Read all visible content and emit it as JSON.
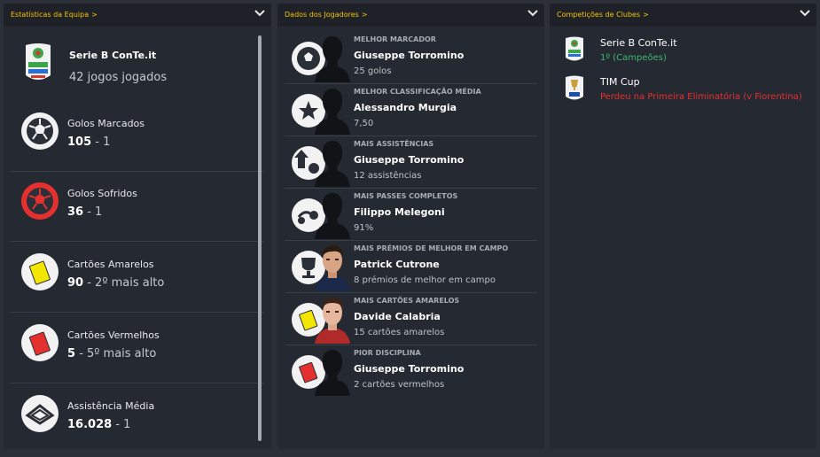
{
  "colors": {
    "accent": "#f5c500",
    "success": "#3db870",
    "danger": "#e4312f"
  },
  "team_stats": {
    "title": "Estatísticas da Equipa",
    "competition": {
      "name": "Serie B ConTe.it",
      "played": "42 jogos jogados",
      "badge": "serie-b-logo"
    },
    "items": [
      {
        "label": "Golos Marcados",
        "value": "105",
        "rank": "- 1",
        "icon": "football-icon"
      },
      {
        "label": "Golos Sofridos",
        "value": "36",
        "rank": "- 1",
        "icon": "conceded-ball-icon"
      },
      {
        "label": "Cartões Amarelos",
        "value": "90",
        "rank": "- 2º mais alto",
        "icon": "yellow-card-icon"
      },
      {
        "label": "Cartões Vermelhos",
        "value": "5",
        "rank": "- 5º mais alto",
        "icon": "red-card-icon"
      },
      {
        "label": "Assistência Média",
        "value": "16.028",
        "rank": "- 1",
        "icon": "stadium-icon"
      }
    ]
  },
  "player_stats": {
    "title": "Dados dos Jogadores",
    "items": [
      {
        "category": "Melhor Marcador",
        "player": "Giuseppe Torromino",
        "stat": "25 golos",
        "icon": "football-icon",
        "has_photo": false
      },
      {
        "category": "Melhor Classificação Média",
        "player": "Alessandro Murgia",
        "stat": "7,50",
        "icon": "star-icon",
        "has_photo": false
      },
      {
        "category": "Mais Assistências",
        "player": "Giuseppe Torromino",
        "stat": "12 assistências",
        "icon": "assist-icon",
        "has_photo": false
      },
      {
        "category": "Mais Passes Completos",
        "player": "Filippo Melegoni",
        "stat": "91%",
        "icon": "pass-icon",
        "has_photo": false
      },
      {
        "category": "Mais Prémios de Melhor em Campo",
        "player": "Patrick Cutrone",
        "stat": "8 prémios de melhor em campo",
        "icon": "trophy-icon",
        "has_photo": true
      },
      {
        "category": "Mais Cartões Amarelos",
        "player": "Davide Calabria",
        "stat": "15 cartões amarelos",
        "icon": "yellow-card-icon",
        "has_photo": true
      },
      {
        "category": "Pior Disciplina",
        "player": "Giuseppe Torromino",
        "stat": "2 cartões vermelhos",
        "icon": "red-card-icon",
        "has_photo": false
      }
    ]
  },
  "club_comps": {
    "title": "Competições de Clubes",
    "items": [
      {
        "name": "Serie B ConTe.it",
        "result": "1º (Campeões)",
        "status": "success",
        "badge": "serie-b-logo"
      },
      {
        "name": "TIM Cup",
        "result": "Perdeu na Primeira Eliminatória (v Fiorentina)",
        "status": "danger",
        "badge": "tim-cup-logo"
      }
    ]
  }
}
